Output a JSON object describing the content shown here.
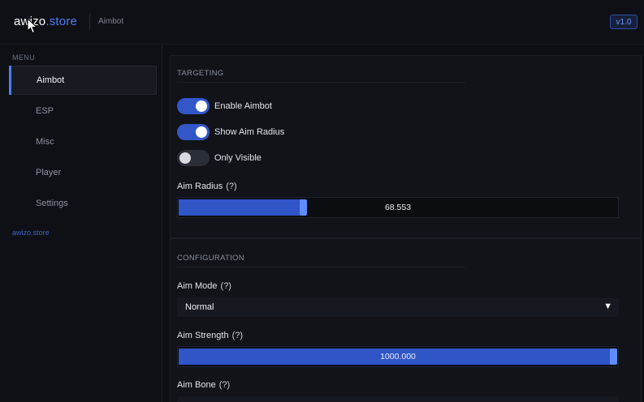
{
  "header": {
    "logo_brand": "awizo",
    "logo_tld": ".store",
    "breadcrumb": "Aimbot",
    "version": "v1.0"
  },
  "sidebar": {
    "menu_label": "MENU",
    "items": [
      {
        "label": "Aimbot",
        "active": true
      },
      {
        "label": "ESP",
        "active": false
      },
      {
        "label": "Misc",
        "active": false
      },
      {
        "label": "Player",
        "active": false
      },
      {
        "label": "Settings",
        "active": false
      }
    ],
    "footer": "awizo.store"
  },
  "targeting": {
    "title": "TARGETING",
    "toggles": [
      {
        "label": "Enable Aimbot",
        "on": true
      },
      {
        "label": "Show Aim Radius",
        "on": true
      },
      {
        "label": "Only Visible",
        "on": false
      }
    ],
    "aim_radius": {
      "label": "Aim Radius",
      "hint": "(?)",
      "value": "68.553",
      "fill_fraction": 0.28
    }
  },
  "configuration": {
    "title": "CONFIGURATION",
    "aim_mode": {
      "label": "Aim Mode",
      "hint": "(?)",
      "selected": "Normal",
      "caret": "▼"
    },
    "aim_strength": {
      "label": "Aim Strength",
      "hint": "(?)",
      "value": "1000.000",
      "fill_fraction": 1.0
    },
    "aim_bone": {
      "label": "Aim Bone",
      "hint": "(?)"
    }
  },
  "colors": {
    "accent": "#4f7df3",
    "toggle_on": "#3357c9",
    "slider_fill": "#2f55c7",
    "background": "#0d0f14"
  }
}
